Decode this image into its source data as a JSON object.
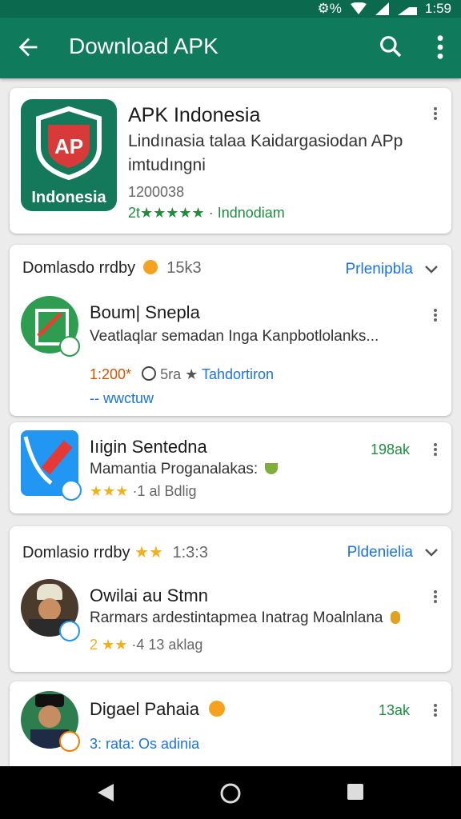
{
  "status": {
    "time": "1:59",
    "icons_text": "⚙%"
  },
  "appbar": {
    "title": "Download APK"
  },
  "featured": {
    "name": "APK Indonesia",
    "description": "Lindınasia talaa Kaidargasiodan APp imtudıngni",
    "count": "1200038",
    "rating_prefix": "2t★★★★★",
    "separator": "·",
    "developer": "Indnodiam",
    "icon_label": "Indonesia",
    "icon_letters": "AP"
  },
  "section1": {
    "title": "Domlasdo rrdby",
    "meta": "15k3",
    "link": "Prlenipbla",
    "app1": {
      "name": "Boum| Snepla",
      "description": "Veatlaqlar semadan Inga Kanpbotlolanks...",
      "count": "1:200*",
      "meta_b": "5ra",
      "developer": "Tahdortiron",
      "extra": "-- wwctuw"
    }
  },
  "app2": {
    "name": "Iıigin Sentedna",
    "description": "Mamantia Proganalakas:",
    "stars": "★★★",
    "meta": "·1 al Bdlig",
    "size": "198ak"
  },
  "section2": {
    "title": "Domlasio rrdby",
    "stars": "★★",
    "meta": "1:3:3",
    "link": "Pldenielia",
    "app1": {
      "name": "Owilai au Stmn",
      "description": "Rarmars ardestintapmea Inatrag Moalnlana",
      "rating": "2",
      "stars": "★★",
      "meta": "·4 13 aklag"
    }
  },
  "app4": {
    "name": "Digael Pahaia",
    "description": "3: rata: Os adinia",
    "size": "13ak"
  },
  "colors": {
    "appbar": "#0f7a5c",
    "statusbar": "#0b6a4e",
    "accent_green": "#1e8e3e",
    "accent_blue": "#1a73e8",
    "star": "#f2b01e"
  }
}
